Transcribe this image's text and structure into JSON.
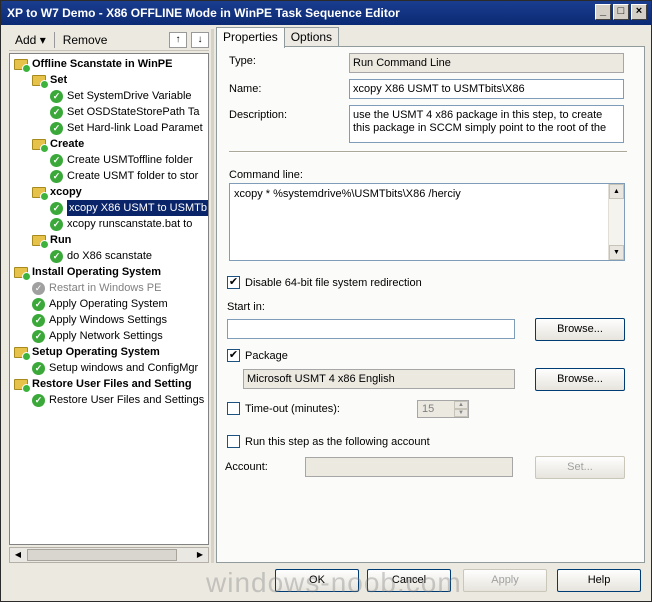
{
  "window": {
    "title": "XP to W7 Demo - X86 OFFLINE Mode in WinPE Task Sequence Editor"
  },
  "toolbar": {
    "add_label": "Add",
    "remove_label": "Remove"
  },
  "tree": {
    "items": [
      {
        "label": "Offline Scanstate in WinPE",
        "kind": "group",
        "level": 0
      },
      {
        "label": "Set",
        "kind": "group",
        "level": 1
      },
      {
        "label": "Set SystemDrive Variable",
        "kind": "step",
        "level": 2
      },
      {
        "label": "Set OSDStateStorePath Ta",
        "kind": "step",
        "level": 2
      },
      {
        "label": "Set Hard-link Load Paramet",
        "kind": "step",
        "level": 2
      },
      {
        "label": "Create",
        "kind": "group",
        "level": 1
      },
      {
        "label": "Create USMToffline folder",
        "kind": "step",
        "level": 2
      },
      {
        "label": "Create USMT folder to stor",
        "kind": "step",
        "level": 2
      },
      {
        "label": "xcopy",
        "kind": "group",
        "level": 1
      },
      {
        "label": "xcopy X86 USMT to USMTb",
        "kind": "step",
        "level": 2,
        "selected": true
      },
      {
        "label": "xcopy runscanstate.bat to",
        "kind": "step",
        "level": 2
      },
      {
        "label": "Run",
        "kind": "group",
        "level": 1
      },
      {
        "label": "do X86 scanstate",
        "kind": "step",
        "level": 2
      },
      {
        "label": "Install Operating System",
        "kind": "group",
        "level": 0
      },
      {
        "label": "Restart in Windows PE",
        "kind": "step-disabled",
        "level": 1
      },
      {
        "label": "Apply Operating System",
        "kind": "step",
        "level": 1
      },
      {
        "label": "Apply Windows Settings",
        "kind": "step",
        "level": 1
      },
      {
        "label": "Apply Network Settings",
        "kind": "step",
        "level": 1
      },
      {
        "label": "Setup Operating System",
        "kind": "group",
        "level": 0
      },
      {
        "label": "Setup windows and ConfigMgr",
        "kind": "step",
        "level": 1
      },
      {
        "label": "Restore User Files and Setting",
        "kind": "group",
        "level": 0
      },
      {
        "label": "Restore User Files and Settings",
        "kind": "step",
        "level": 1
      }
    ]
  },
  "tabs": {
    "properties": "Properties",
    "options": "Options"
  },
  "form": {
    "type_label": "Type:",
    "type_value": "Run Command Line",
    "name_label": "Name:",
    "name_value": "xcopy X86 USMT to USMTbits\\X86",
    "description_label": "Description:",
    "description_value": "use the USMT 4  x86 package in this step, to create this package in SCCM simply point to the root of the",
    "command_label": "Command line:",
    "command_value": "xcopy * %systemdrive%\\USMTbits\\X86 /herciy",
    "disable_redirection_label": "Disable 64-bit file system redirection",
    "start_in_label": "Start in:",
    "start_in_value": "",
    "browse_label": "Browse...",
    "package_label": "Package",
    "package_value": "Microsoft USMT 4 x86 English",
    "timeout_label": "Time-out (minutes):",
    "timeout_value": "15",
    "run_as_label": "Run this step as the following account",
    "account_label": "Account:",
    "account_value": "",
    "set_label": "Set..."
  },
  "buttons": {
    "ok": "OK",
    "cancel": "Cancel",
    "apply": "Apply",
    "help": "Help"
  },
  "watermark": "windows-noob.com"
}
